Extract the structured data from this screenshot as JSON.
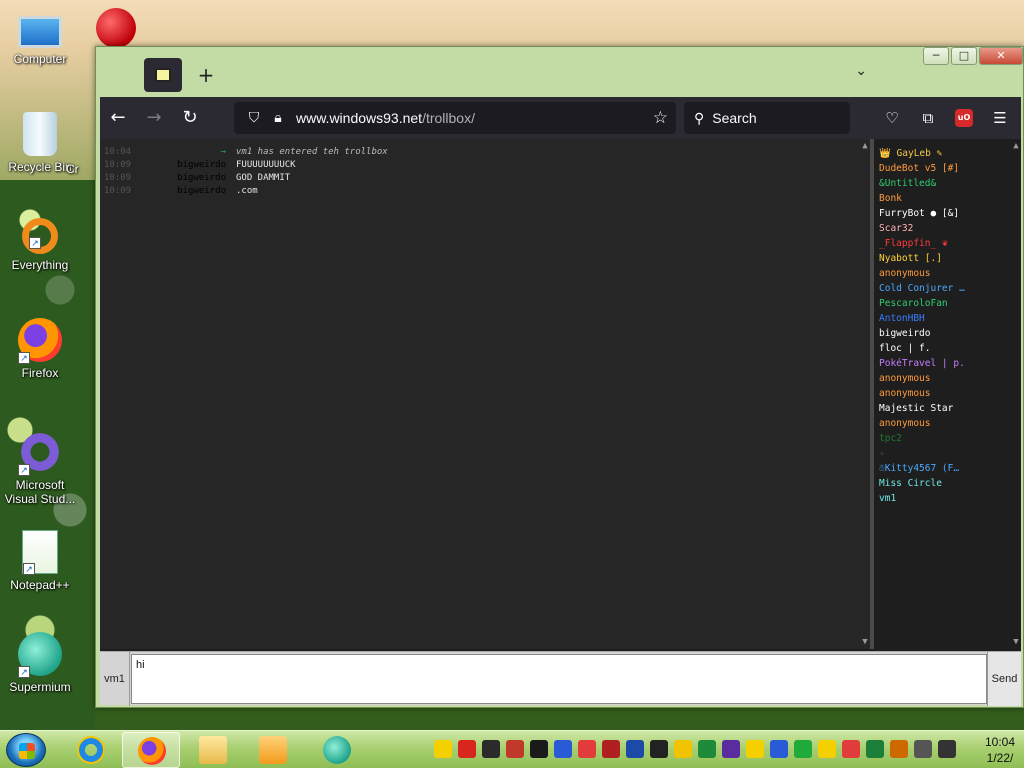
{
  "desktop": {
    "icons": [
      {
        "label": "Computer",
        "icon": "computer-icon"
      },
      {
        "label": "Recycle Bin",
        "icon": "recycle-bin-icon"
      },
      {
        "label": "Everything",
        "icon": "everything-icon"
      },
      {
        "label": "Firefox",
        "icon": "firefox-icon"
      },
      {
        "label": "Microsoft Visual Stud...",
        "icon": "visual-studio-icon"
      },
      {
        "label": "Notepad++",
        "icon": "notepad-plus-plus-icon"
      },
      {
        "label": "Supermium",
        "icon": "supermium-icon"
      }
    ],
    "partial_label": "Cr"
  },
  "browser": {
    "window_controls": {
      "minimize": "─",
      "maximize": "□",
      "close": "✕"
    },
    "tab_new": "+",
    "tab_list": "⌄",
    "nav": {
      "back": "←",
      "forward": "→",
      "reload": "↻"
    },
    "url": {
      "domain": "www.windows93.net",
      "path": "/trollbox/"
    },
    "search_placeholder": "Search",
    "ublock_label": "uO"
  },
  "trollbox": {
    "messages": [
      {
        "time": "10:04",
        "nick": "→",
        "text": "vm1 has entered teh trollbox",
        "system": true
      },
      {
        "time": "10:09",
        "nick": "bigweirdo",
        "text": "FUUUUUUUUCK",
        "system": false
      },
      {
        "time": "10:09",
        "nick": "bigweirdo",
        "text": "GOD DAMMIT",
        "system": false
      },
      {
        "time": "10:09",
        "nick": "bigweirdo",
        "text": ".com",
        "system": false
      }
    ],
    "users": [
      {
        "name": "👑 GayLeb ✎",
        "color": "#f2c94c"
      },
      {
        "name": "DudeBot v5 [#]",
        "color": "#ff9a3c"
      },
      {
        "name": "&Untitled&",
        "color": "#2ecc71"
      },
      {
        "name": "Bonk",
        "color": "#ff9a3c"
      },
      {
        "name": "FurryBot ● [&]",
        "color": "#ffffff"
      },
      {
        "name": "Scar32",
        "color": "#ffb3b3"
      },
      {
        "name": "_Flappfin_ ❦",
        "color": "#ff3b3b"
      },
      {
        "name": "Nyabott [.]",
        "color": "#ffd23c"
      },
      {
        "name": "anonymous",
        "color": "#ff9a3c"
      },
      {
        "name": "Cold Conjurer …",
        "color": "#4aa8ff"
      },
      {
        "name": "PescaroloFan",
        "color": "#2ecc71"
      },
      {
        "name": "AntonHBH",
        "color": "#3b7dff"
      },
      {
        "name": "bigweirdo",
        "color": "#ffffff"
      },
      {
        "name": "floc | f.",
        "color": "#ffffff"
      },
      {
        "name": "PokéTravel | p.",
        "color": "#c77dff"
      },
      {
        "name": "anonymous",
        "color": "#ff9a3c"
      },
      {
        "name": "anonymous",
        "color": "#ff9a3c"
      },
      {
        "name": "Majestic Star",
        "color": "#ffffff"
      },
      {
        "name": "anonymous",
        "color": "#ff9a3c"
      },
      {
        "name": "tpc2",
        "color": "#1f7a2f"
      },
      {
        "name": "✧",
        "color": "#555555"
      },
      {
        "name": "☃Kitty4567 (F…",
        "color": "#4aa8ff"
      },
      {
        "name": "Miss Circle",
        "color": "#6ee7e7"
      },
      {
        "name": "vm1",
        "color": "#6ee7e7"
      }
    ],
    "my_nick": "vm1",
    "input_value": "hi",
    "send_label": "Send"
  },
  "taskbar": {
    "apps": [
      {
        "name": "internet-explorer",
        "active": false
      },
      {
        "name": "firefox",
        "active": true
      },
      {
        "name": "file-explorer",
        "active": false
      },
      {
        "name": "media-player",
        "active": false
      },
      {
        "name": "supermium",
        "active": false
      }
    ],
    "tray_colors": [
      "#f5d000",
      "#d8261e",
      "#2b2b2b",
      "#c0392b",
      "#1a1a1a",
      "#2a5bd7",
      "#e23b3b",
      "#b02020",
      "#1b4aa8",
      "#222222",
      "#f2c300",
      "#1e8a3a",
      "#5a2ca0",
      "#f5d000",
      "#2a5bd7",
      "#1faa3a",
      "#f5d000",
      "#e23b3b",
      "#1b7f3a",
      "#cc6a00",
      "#555555",
      "#333333"
    ],
    "clock_time": "10:04",
    "clock_date": "1/22/"
  }
}
